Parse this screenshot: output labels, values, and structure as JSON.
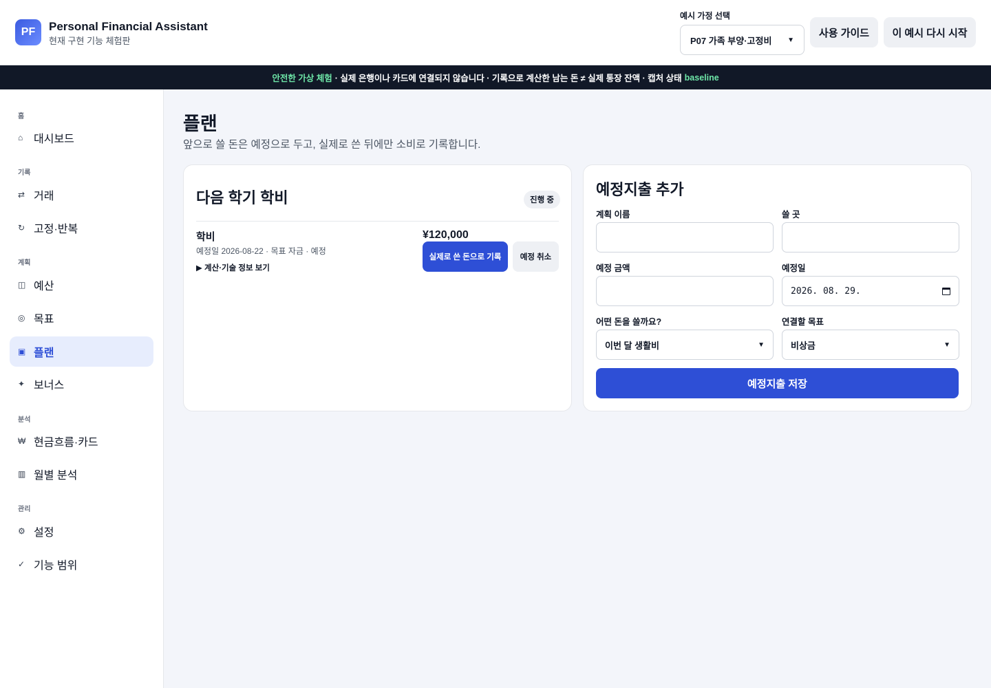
{
  "header": {
    "logo_text": "PF",
    "app_title": "Personal Financial Assistant",
    "app_subtitle": "현재 구현 기능 체험판",
    "household_label": "예시 가정 선택",
    "household_value": "P07 가족 부양·고정비",
    "guide_label": "사용 가이드",
    "restart_label": "이 예시 다시 시작"
  },
  "banner": {
    "safe_label": "안전한 가상 체험",
    "text1": "· 실제 은행이나 카드에 연결되지 않습니다 · 기록으로 계산한 남는 돈 ≠ 실제 통장 잔액 · 캡처 상태",
    "state": "baseline"
  },
  "sidebar": {
    "sections": {
      "home": "홈",
      "record": "기록",
      "plan": "계획",
      "analysis": "분석",
      "manage": "관리"
    },
    "items": {
      "dashboard": "대시보드",
      "transactions": "거래",
      "recurring": "고정·반복",
      "budget": "예산",
      "goals": "목표",
      "plan": "플랜",
      "bonus": "보너스",
      "cashflow": "현금흐름·카드",
      "monthly": "월별 분석",
      "settings": "설정",
      "scope": "기능 범위"
    },
    "icons": {
      "dashboard": "⌂",
      "transactions": "⇄",
      "recurring": "↻",
      "budget": "◫",
      "goals": "◎",
      "plan": "▣",
      "bonus": "✦",
      "cashflow": "₩",
      "monthly": "▥",
      "settings": "⚙",
      "scope": "✓"
    }
  },
  "main": {
    "title": "플랜",
    "description": "앞으로 쓸 돈은 예정으로 두고, 실제로 쓴 뒤에만 소비로 기록합니다.",
    "plan_card": {
      "title": "다음 학기 학비",
      "status": "진행 중",
      "item": {
        "name": "학비",
        "meta": "예정일 2026-08-22 · 목표 자금 · 예정",
        "details": "▶  계산·기술 정보 보기",
        "amount": "¥120,000",
        "record_label": "실제로 쓴 돈으로 기록",
        "cancel_label": "예정 취소"
      }
    },
    "form": {
      "title": "예정지출 추가",
      "name_label": "계획 이름",
      "name_value": "",
      "place_label": "쓸 곳",
      "place_value": "",
      "amount_label": "예정 금액",
      "amount_value": "",
      "date_label": "예정일",
      "date_value": "2026. 08. 29.",
      "source_label": "어떤 돈을 쓸까요?",
      "source_value": "이번 달 생활비",
      "goal_label": "연결할 목표",
      "goal_value": "비상금",
      "save_label": "예정지출 저장"
    }
  },
  "colors": {
    "accent": "#2e4fd6",
    "active_bg": "#e7edfd",
    "banner_bg": "#111827",
    "banner_green": "#6ee7a8"
  }
}
